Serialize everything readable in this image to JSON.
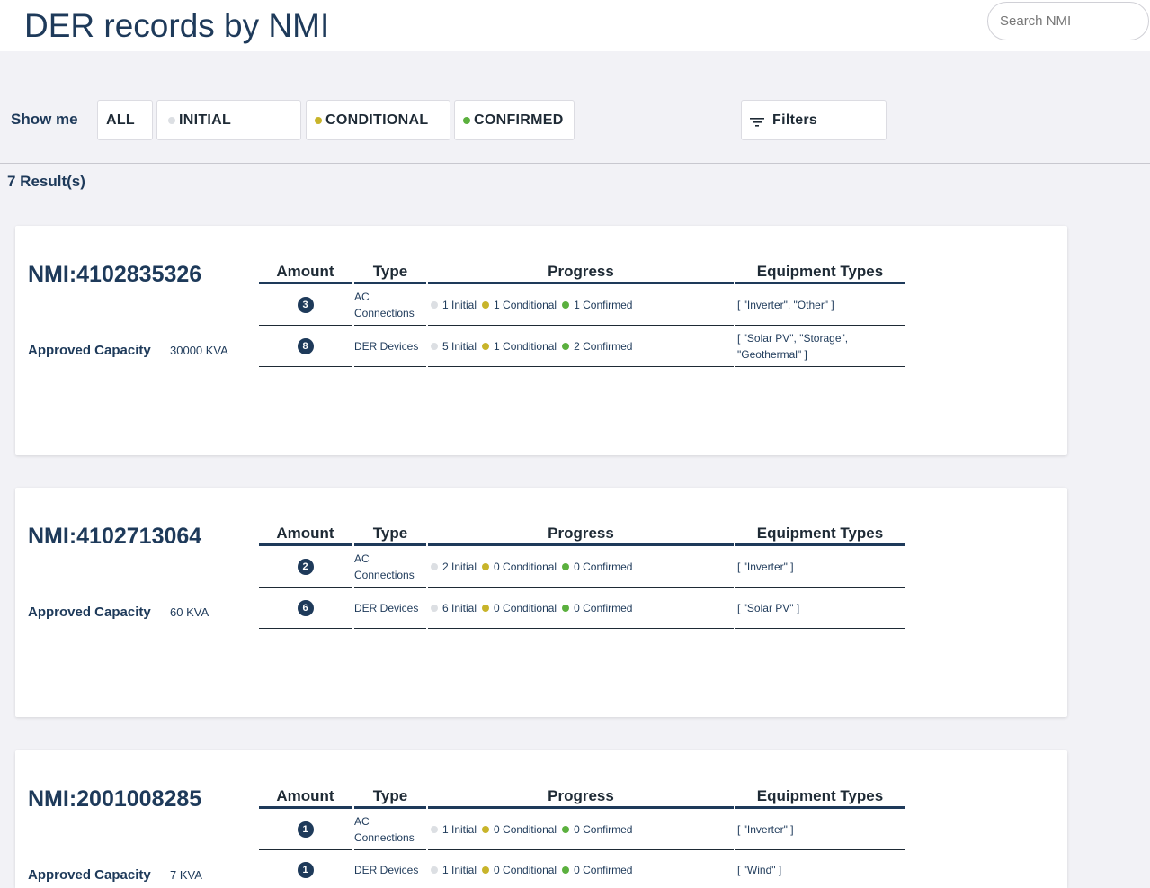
{
  "header": {
    "title": "DER records by NMI",
    "search_placeholder": "Search NMI"
  },
  "toolbar": {
    "show_me_label": "Show me",
    "all_label": "ALL",
    "initial_label": "INITIAL",
    "conditional_label": "CONDITIONAL",
    "confirmed_label": "CONFIRMED",
    "filters_label": "Filters"
  },
  "results_label": "7 Result(s)",
  "columns": {
    "amount": "Amount",
    "type": "Type",
    "progress": "Progress",
    "equipment": "Equipment Types"
  },
  "colors": {
    "primary": "#1e3a5a",
    "initial": "#dcdfe3",
    "conditional": "#c8b42a",
    "confirmed": "#5bb03e"
  },
  "records": [
    {
      "nmi": "NMI:4102835326",
      "capacity_label": "Approved Capacity",
      "capacity_value": "30000 KVA",
      "rows": [
        {
          "amount": "3",
          "type": "AC Connections",
          "initial": "1 Initial",
          "conditional": "1 Conditional",
          "confirmed": "1 Confirmed",
          "equipment": "[ \"Inverter\", \"Other\" ]"
        },
        {
          "amount": "8",
          "type": "DER Devices",
          "initial": "5 Initial",
          "conditional": "1 Conditional",
          "confirmed": "2 Confirmed",
          "equipment": "[ \"Solar PV\", \"Storage\", \"Geothermal\" ]"
        }
      ]
    },
    {
      "nmi": "NMI:4102713064",
      "capacity_label": "Approved Capacity",
      "capacity_value": "60 KVA",
      "rows": [
        {
          "amount": "2",
          "type": "AC Connections",
          "initial": "2 Initial",
          "conditional": "0 Conditional",
          "confirmed": "0 Confirmed",
          "equipment": "[ \"Inverter\" ]"
        },
        {
          "amount": "6",
          "type": "DER Devices",
          "initial": "6 Initial",
          "conditional": "0 Conditional",
          "confirmed": "0 Confirmed",
          "equipment": "[ \"Solar PV\" ]"
        }
      ]
    },
    {
      "nmi": "NMI:2001008285",
      "capacity_label": "Approved Capacity",
      "capacity_value": "7 KVA",
      "rows": [
        {
          "amount": "1",
          "type": "AC Connections",
          "initial": "1 Initial",
          "conditional": "0 Conditional",
          "confirmed": "0 Confirmed",
          "equipment": "[ \"Inverter\" ]"
        },
        {
          "amount": "1",
          "type": "DER Devices",
          "initial": "1 Initial",
          "conditional": "0 Conditional",
          "confirmed": "0 Confirmed",
          "equipment": "[ \"Wind\" ]"
        }
      ]
    }
  ]
}
